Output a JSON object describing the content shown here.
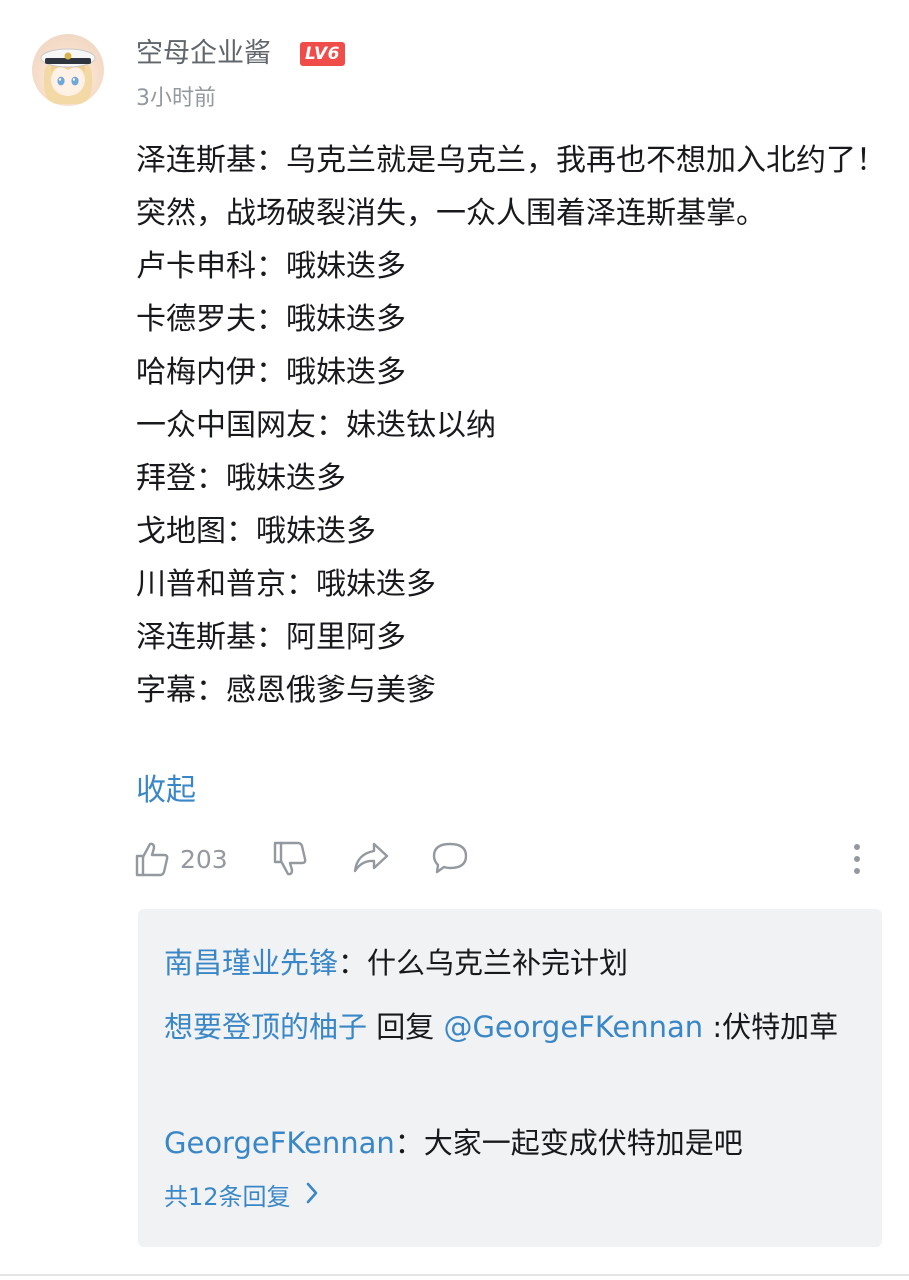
{
  "comment": {
    "username": "空母企业酱",
    "level": "LV6",
    "time": "3小时前",
    "lines": [
      "泽连斯基：乌克兰就是乌克兰，我再也不想加入北约了！",
      "突然，战场破裂消失，一众人围着泽连斯基掌。",
      "卢卡申科：哦妹迭多",
      "卡德罗夫：哦妹迭多",
      "哈梅内伊：哦妹迭多",
      "一众中国网友：妹迭钛以纳",
      "拜登：哦妹迭多",
      "戈地图：哦妹迭多",
      "川普和普京：哦妹迭多",
      "泽连斯基：阿里阿多",
      "字幕：感恩俄爹与美爹"
    ],
    "collapse_label": "收起",
    "like_count": "203"
  },
  "icons": {
    "like": "thumbs-up-icon",
    "dislike": "thumbs-down-icon",
    "share": "share-icon",
    "reply": "comment-bubble-icon",
    "more": "more-vertical-icon"
  },
  "replies": [
    {
      "name": "南昌瑾业先锋",
      "sep": "：",
      "text": "什么乌克兰补完计划"
    },
    {
      "name": "想要登顶的柚子",
      "mid": " 回复 ",
      "mention": "@GeorgeFKennan",
      "text": " :伏特加草"
    },
    {
      "name": "GeorgeFKennan",
      "sep": "：",
      "text": "大家一起变成伏特加是吧"
    }
  ],
  "more_replies_label": "共12条回复",
  "colors": {
    "link_blue": "#3a87c8",
    "level_badge": "#f04c49",
    "reply_bg": "#f1f2f3",
    "muted_text": "#9499a0"
  }
}
